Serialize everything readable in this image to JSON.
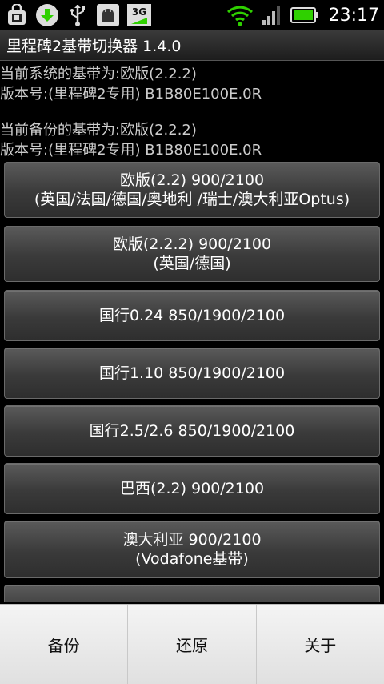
{
  "status_bar": {
    "icons_left": [
      "shopping-bag-icon",
      "download-icon",
      "usb-icon",
      "android-debug-icon",
      "3g-icon"
    ],
    "net_label": "3G",
    "icons_right": [
      "wifi-icon",
      "signal-icon",
      "battery-icon"
    ],
    "time": "23:17",
    "colors": {
      "accent_green": "#2fd000"
    }
  },
  "app": {
    "title": "里程碑2基带切换器 1.4.0"
  },
  "info": {
    "current_line1": "当前系统的基带为:欧版(2.2.2)",
    "current_line2": "版本号:(里程碑2专用) B1B80E100E.0R",
    "backup_line1": "当前备份的基带为:欧版(2.2.2)",
    "backup_line2": "版本号:(里程碑2专用) B1B80E100E.0R"
  },
  "buttons": [
    {
      "line1": "欧版(2.2) 900/2100",
      "line2": "(英国/法国/德国/奥地利 /瑞士/澳大利亚Optus)"
    },
    {
      "line1": "欧版(2.2.2) 900/2100",
      "line2": "(英国/德国)"
    },
    {
      "line1": "国行0.24 850/1900/2100",
      "line2": ""
    },
    {
      "line1": "国行1.10 850/1900/2100",
      "line2": ""
    },
    {
      "line1": "国行2.5/2.6 850/1900/2100",
      "line2": ""
    },
    {
      "line1": "巴西(2.2) 900/2100",
      "line2": ""
    },
    {
      "line1": "澳大利亚 900/2100",
      "line2": "(Vodafone基带)"
    },
    {
      "line1": "",
      "line2": ""
    }
  ],
  "menu": {
    "backup": "备份",
    "restore": "还原",
    "about": "关于"
  }
}
